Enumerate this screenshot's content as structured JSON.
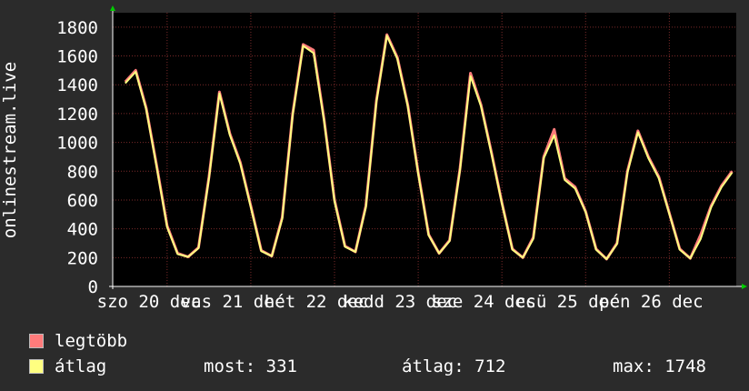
{
  "chart_data": {
    "type": "line",
    "ylabel": "onlinestream.live",
    "ylim": [
      0,
      1900
    ],
    "yticks": [
      0,
      200,
      400,
      600,
      800,
      1000,
      1200,
      1400,
      1600,
      1800
    ],
    "xtick_labels": [
      "szo 20 dec",
      "vas 21 dec",
      "hét 22 dec",
      "kedd 23 dec",
      "sze 24 dec",
      "csü 25 dec",
      "pén 26 dec"
    ],
    "grid": true,
    "x_days": [
      0,
      0.125,
      0.25,
      0.375,
      0.5,
      0.625,
      0.75,
      0.875,
      1.0,
      1.125,
      1.25,
      1.375,
      1.5,
      1.625,
      1.75,
      1.875,
      2.0,
      2.125,
      2.25,
      2.375,
      2.5,
      2.625,
      2.75,
      2.875,
      3.0,
      3.125,
      3.25,
      3.375,
      3.5,
      3.625,
      3.75,
      3.875,
      4.0,
      4.125,
      4.25,
      4.375,
      4.5,
      4.625,
      4.75,
      4.875,
      5.0,
      5.125,
      5.25,
      5.375,
      5.5,
      5.625,
      5.75,
      5.875,
      6.0,
      6.125,
      6.25,
      6.375,
      6.5,
      6.625,
      6.75,
      6.875,
      7.0,
      7.125,
      7.25
    ],
    "series": [
      {
        "name": "legtöbb",
        "color": "#ff7b7b",
        "values": [
          1420,
          1500,
          1240,
          840,
          420,
          230,
          205,
          270,
          760,
          1350,
          1060,
          860,
          560,
          250,
          210,
          480,
          1200,
          1680,
          1640,
          1160,
          600,
          280,
          240,
          560,
          1290,
          1748,
          1590,
          1260,
          790,
          360,
          230,
          320,
          820,
          1480,
          1260,
          930,
          580,
          260,
          200,
          340,
          900,
          1090,
          750,
          690,
          520,
          260,
          190,
          300,
          800,
          1080,
          900,
          760,
          510,
          260,
          195,
          360,
          560,
          700,
          800
        ]
      },
      {
        "name": "átlag",
        "color": "#ffff80",
        "values": [
          1410,
          1490,
          1230,
          830,
          410,
          225,
          205,
          265,
          750,
          1340,
          1050,
          850,
          550,
          245,
          210,
          470,
          1190,
          1670,
          1620,
          1150,
          590,
          275,
          240,
          550,
          1280,
          1740,
          1580,
          1250,
          780,
          355,
          230,
          315,
          810,
          1460,
          1250,
          920,
          575,
          255,
          200,
          330,
          890,
          1050,
          740,
          680,
          515,
          255,
          190,
          295,
          790,
          1070,
          890,
          750,
          505,
          255,
          195,
          331,
          550,
          690,
          790
        ]
      }
    ]
  },
  "legend": {
    "items": [
      {
        "label": "legtöbb",
        "color": "#ff7b7b"
      },
      {
        "label": "átlag",
        "color": "#ffff80"
      }
    ]
  },
  "stats": {
    "most": "most: 331",
    "atlag": "átlag: 712",
    "max": "max: 1748"
  }
}
